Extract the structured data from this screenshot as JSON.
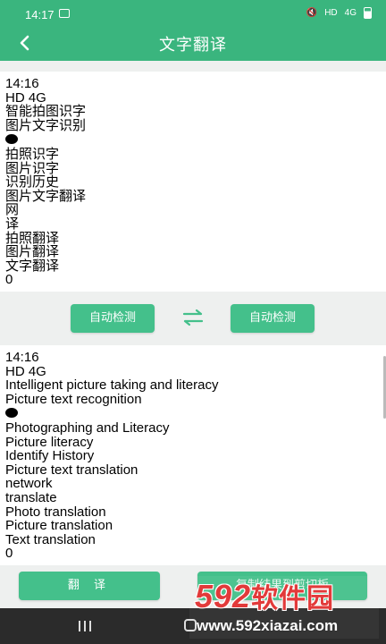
{
  "status_bar": {
    "time": "14:17",
    "network": "HD",
    "signal": "4G"
  },
  "app_bar": {
    "title": "文字翻译",
    "back_icon": "back-arrow-icon"
  },
  "source": {
    "lines": [
      "14:16",
      "HD 4G",
      "智能拍图识字",
      "图片文字识别",
      "",
      "拍照识字",
      "图片识字",
      "识别历史",
      "图片文字翻译",
      "网",
      "译",
      "拍照翻译",
      "图片翻译",
      "文字翻译",
      "0"
    ]
  },
  "languages": {
    "source_label": "自动检测",
    "target_label": "自动检测",
    "swap_icon": "swap-arrows-icon"
  },
  "result": {
    "lines": [
      "14:16",
      "HD 4G",
      "Intelligent picture taking and literacy",
      "Picture text recognition",
      "",
      "Photographing and Literacy",
      "Picture literacy",
      "Identify History",
      "Picture text translation",
      "network",
      "translate",
      "Photo translation",
      "Picture translation",
      "Text translation",
      "0"
    ]
  },
  "actions": {
    "translate_label": "翻 译",
    "copy_label": "复制结果到剪切板"
  },
  "watermark": {
    "logo": "592软件园",
    "logo_num": "592",
    "logo_cn": "软件园",
    "url": "www.592xiazai.com"
  },
  "colors": {
    "primary": "#3ab57e",
    "button": "#44c08b",
    "background": "#eef0ef"
  }
}
